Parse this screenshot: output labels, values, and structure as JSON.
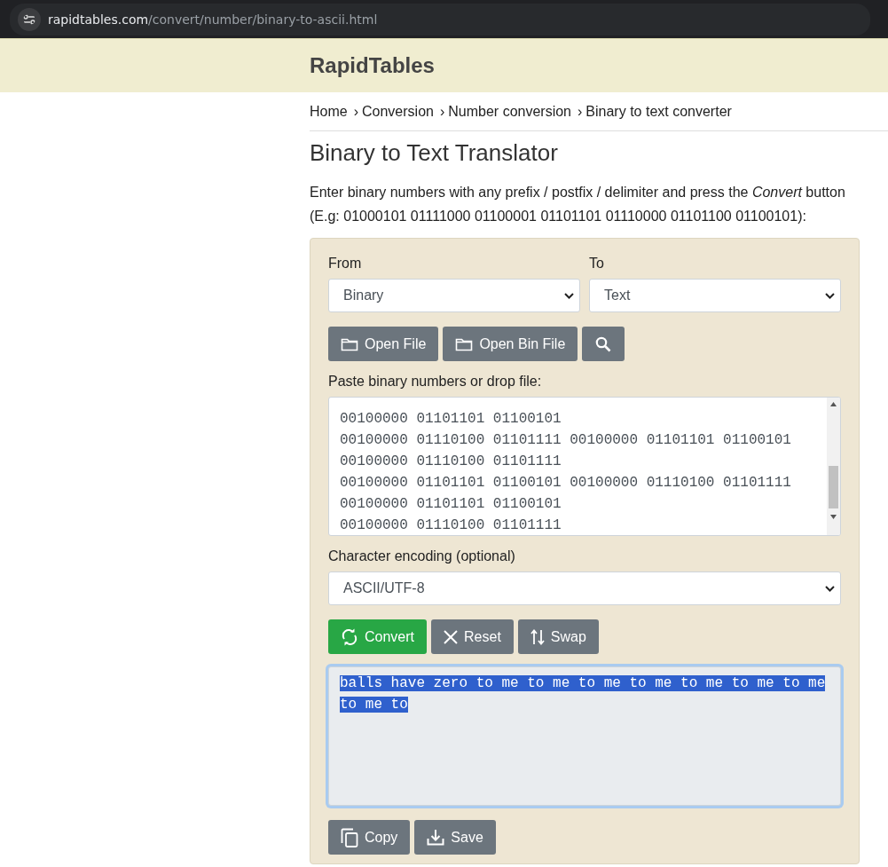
{
  "browser": {
    "url_domain": "rapidtables.com",
    "url_path": "/convert/number/binary-to-ascii.html"
  },
  "site": {
    "logo": "RapidTables"
  },
  "breadcrumb": [
    {
      "label": "Home"
    },
    {
      "label": "Conversion",
      "sep": "›"
    },
    {
      "label": "Number conversion",
      "sep": "›"
    },
    {
      "label": "Binary to text converter",
      "sep": "›"
    }
  ],
  "page": {
    "title": "Binary to Text Translator",
    "intro": "Enter binary numbers with any prefix / postfix / delimiter and press the *Convert* button",
    "example": "(E.g: 01000101 01111000 01100001 01101101 01110000 01101100 01100101):"
  },
  "converter": {
    "from": {
      "label": "From",
      "value": "Binary"
    },
    "to": {
      "label": "To",
      "value": "Text"
    },
    "file_buttons": [
      {
        "kind": "folder",
        "label": "Open File"
      },
      {
        "kind": "folder",
        "label": "Open Bin File"
      },
      {
        "kind": "search"
      }
    ],
    "input_label": "Paste binary numbers or drop file:",
    "input_lines": [
      "00100000 01101101 01100101",
      "00100000 01110100 01101111 00100000 01101101 01100101",
      "00100000 01110100 01101111",
      "00100000 01101101 01100101 00100000 01110100 01101111",
      "00100000 01101101 01100101",
      "00100000 01110100 01101111"
    ],
    "encoding": {
      "label": "Character encoding (optional)",
      "value": "ASCII/UTF-8"
    },
    "action_buttons": [
      {
        "kind": "convert",
        "label": "Convert"
      },
      {
        "kind": "reset",
        "label": "Reset"
      },
      {
        "kind": "swap",
        "label": "Swap"
      }
    ],
    "output": {
      "value": "balls have zero to me to me to me to me to me to me to me to me to",
      "selected": true
    },
    "output_buttons": [
      {
        "kind": "copy",
        "label": "Copy"
      },
      {
        "kind": "save",
        "label": "Save"
      }
    ]
  }
}
